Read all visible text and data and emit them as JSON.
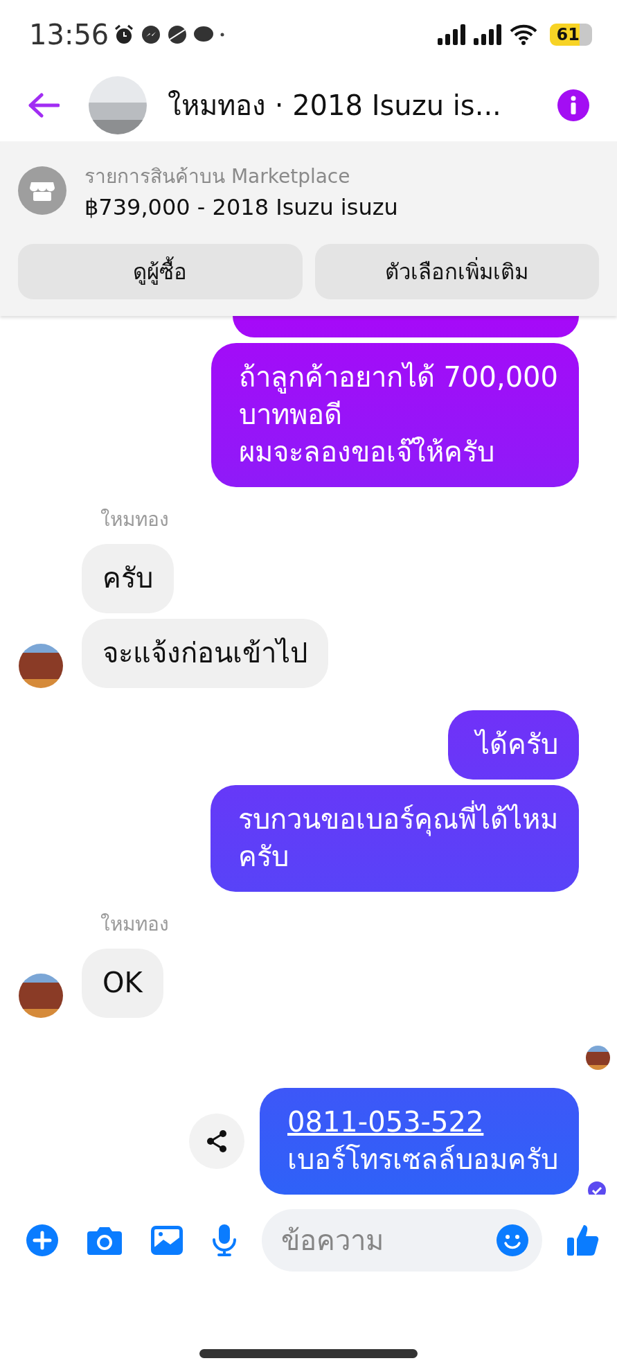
{
  "status_bar": {
    "time": "13:56",
    "battery": "61"
  },
  "header": {
    "title": "ใหมทอง · 2018 Isuzu is..."
  },
  "listing": {
    "label": "รายการสินค้าบน Marketplace",
    "title": "฿739,000 - 2018 Isuzu isuzu",
    "buttons": [
      "ดูผู้ซื้อ",
      "ตัวเลือกเพิ่มเติม"
    ]
  },
  "messages": [
    {
      "kind": "outgoing_cut"
    },
    {
      "kind": "outgoing",
      "text": "ถ้าลูกค้าอยากได้ 700,000\nบาทพอดี\nผมจะลองขอเจ๊ให้ครับ"
    },
    {
      "kind": "sender",
      "text": "ใหมทอง"
    },
    {
      "kind": "incoming",
      "text": "ครับ",
      "avatar": false
    },
    {
      "kind": "incoming",
      "text": "จะแจ้งก่อนเข้าไป",
      "avatar": true
    },
    {
      "kind": "outgoing",
      "text": "ได้ครับ"
    },
    {
      "kind": "outgoing",
      "text": "รบกวนขอเบอร์คุณพี่ได้ไหม\nครับ"
    },
    {
      "kind": "sender",
      "text": "ใหมทอง"
    },
    {
      "kind": "incoming",
      "text": "OK",
      "avatar": true
    },
    {
      "kind": "seen"
    },
    {
      "kind": "outgoing",
      "link": "0811-053-522",
      "text": "เบอร์โทรเซลล์บอมครับ",
      "share": true,
      "delivered": true
    }
  ],
  "composer": {
    "placeholder": "ข้อความ"
  }
}
